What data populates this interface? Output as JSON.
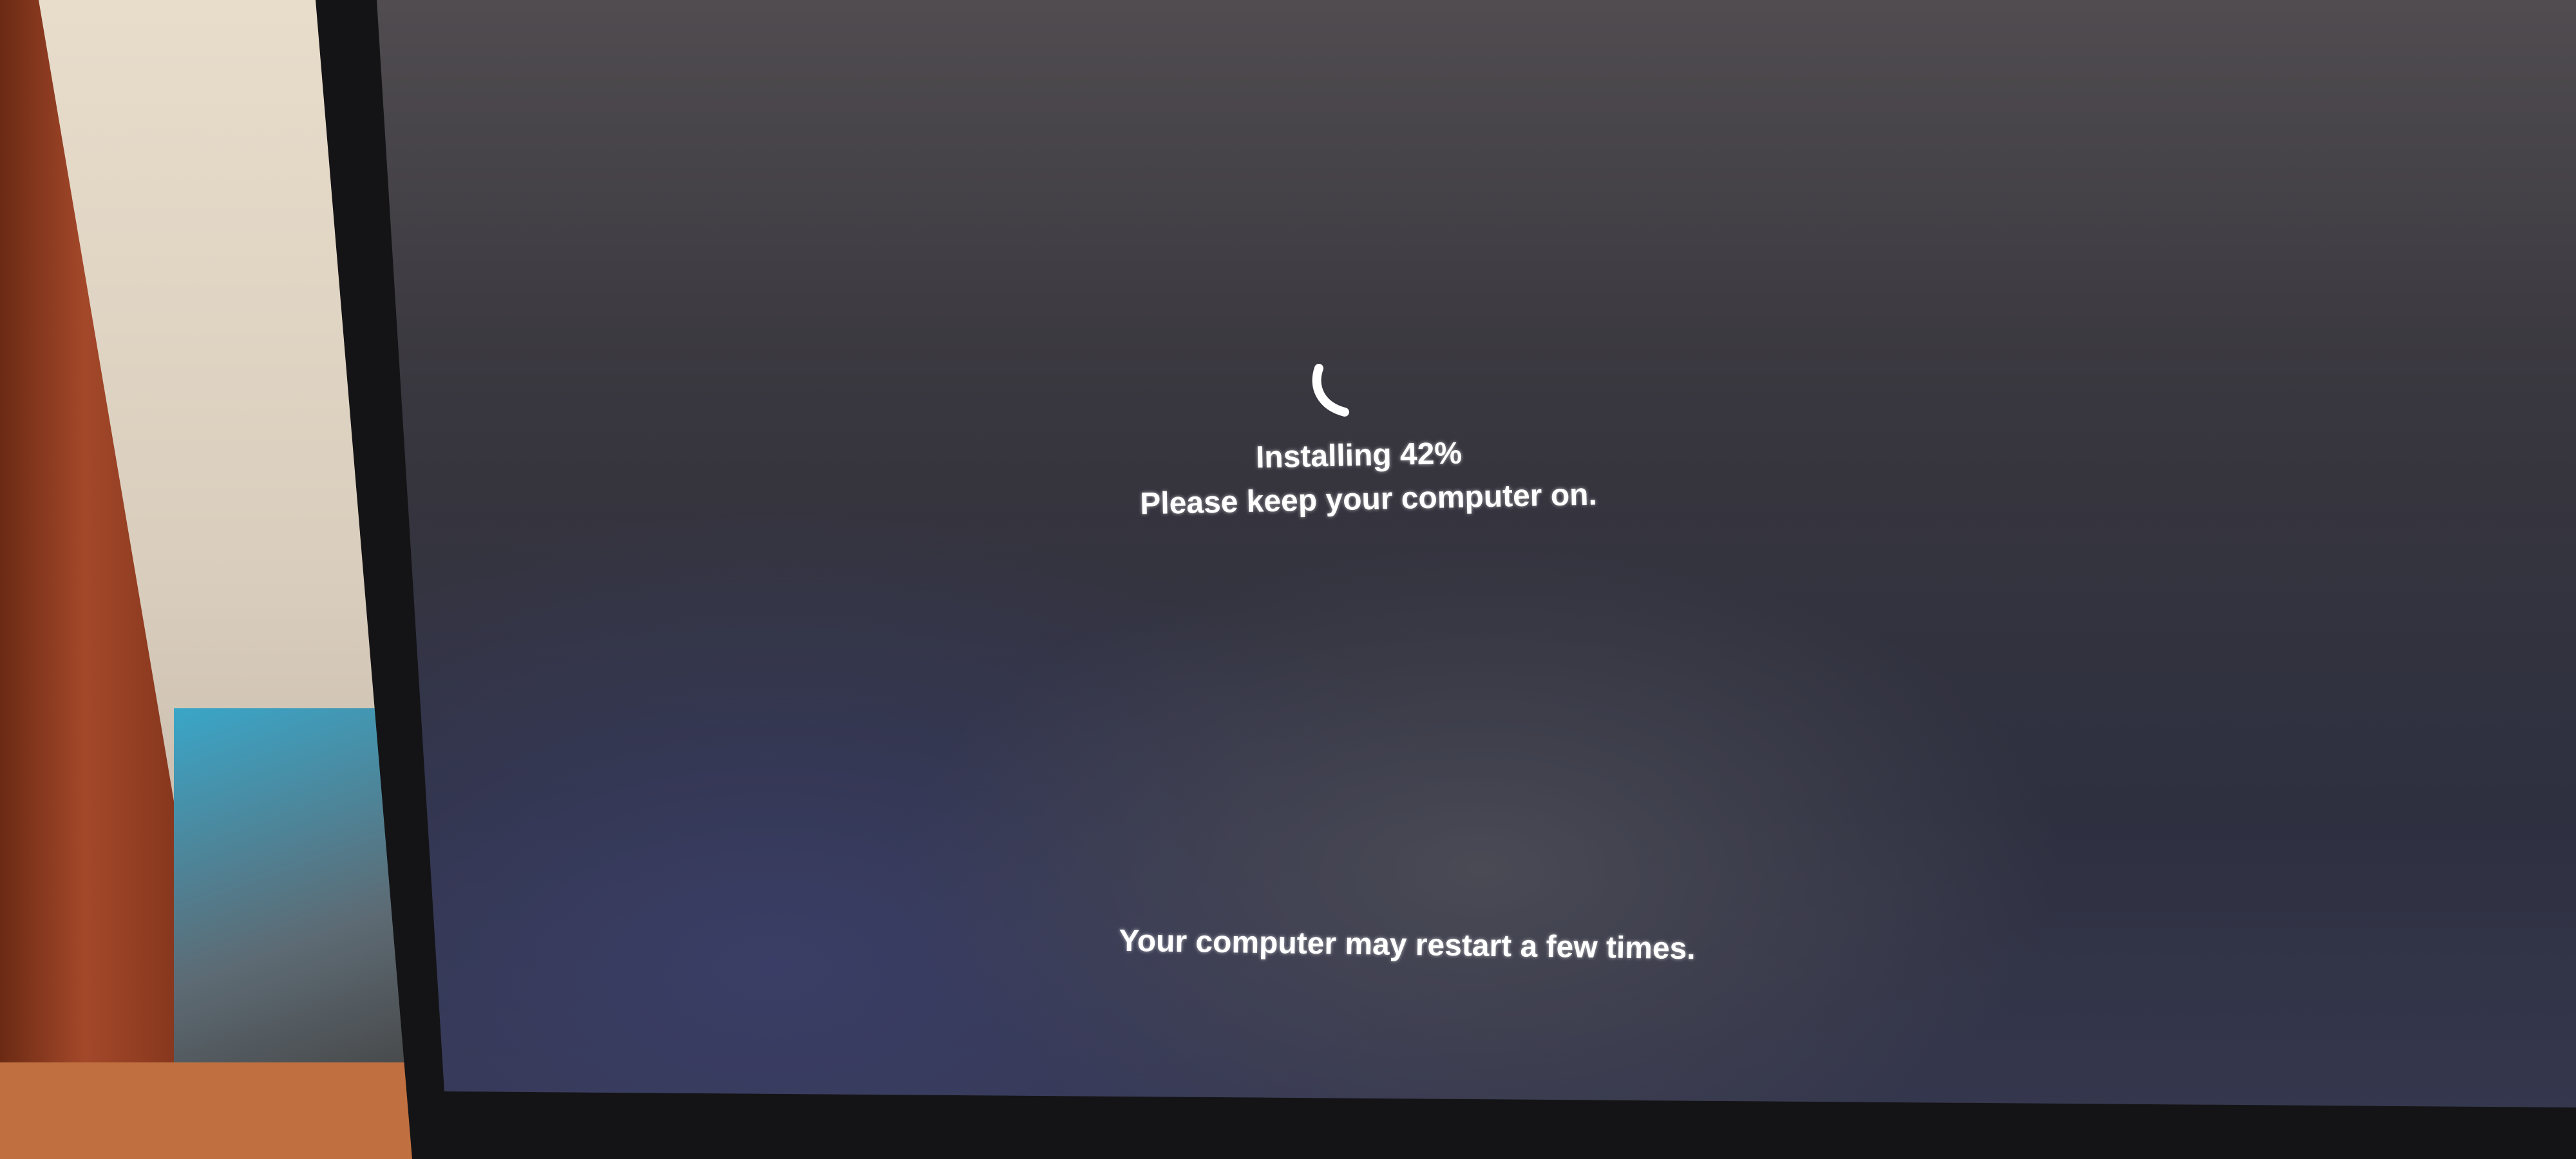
{
  "install_screen": {
    "status_label": "Installing  42%",
    "progress_percent": 42,
    "keep_on_message": "Please keep your computer on.",
    "restart_notice": "Your computer may restart a few times."
  },
  "icons": {
    "spinner": "loading-spinner-icon"
  }
}
